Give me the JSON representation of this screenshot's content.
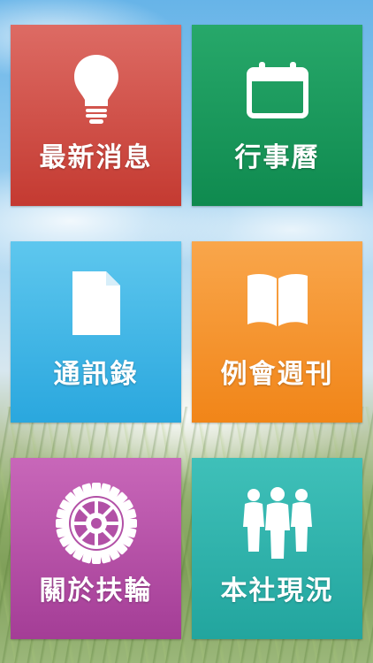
{
  "tiles": [
    {
      "label": "最新消息",
      "icon": "lightbulb-icon",
      "color_top": "#dd6b64",
      "color_bottom": "#c43a31"
    },
    {
      "label": "行事曆",
      "icon": "calendar-icon",
      "color_top": "#27a86a",
      "color_bottom": "#0f8a4f"
    },
    {
      "label": "通訊錄",
      "icon": "document-icon",
      "color_top": "#5ec7ee",
      "color_bottom": "#2aa7de"
    },
    {
      "label": "例會週刊",
      "icon": "open-book-icon",
      "color_top": "#f9a64b",
      "color_bottom": "#f18518"
    },
    {
      "label": "關於扶輪",
      "icon": "rotary-wheel-icon",
      "color_top": "#c867b9",
      "color_bottom": "#a43d96"
    },
    {
      "label": "本社現況",
      "icon": "people-group-icon",
      "color_top": "#3fc0b9",
      "color_bottom": "#22a59e"
    }
  ]
}
